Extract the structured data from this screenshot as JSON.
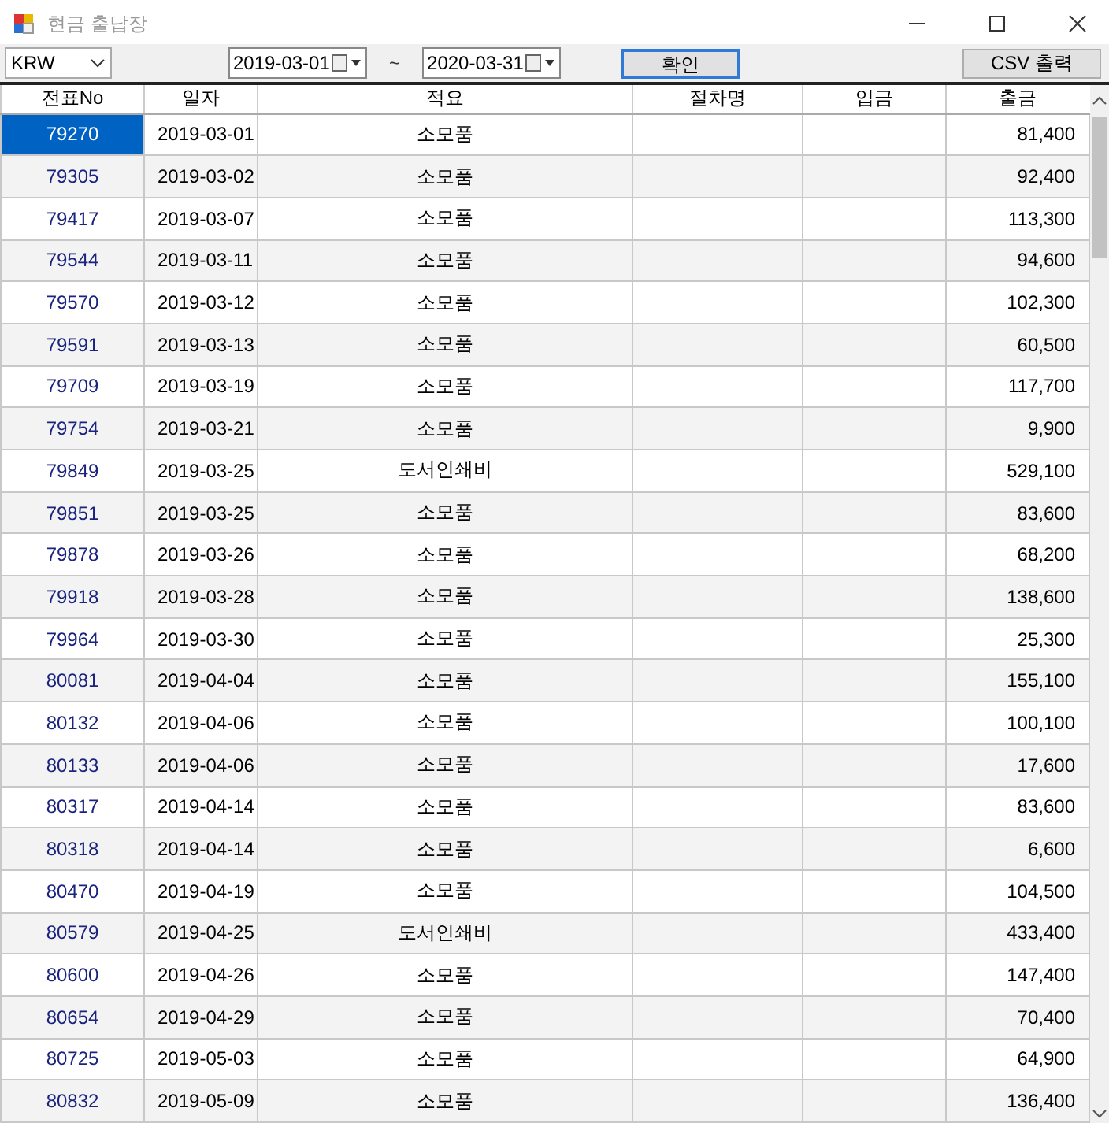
{
  "window": {
    "title": "현금 출납장"
  },
  "toolbar": {
    "currency": "KRW",
    "date_from": "2019-03-01",
    "separator": "~",
    "date_to": "2020-03-31",
    "confirm_button": "확인",
    "export_button": "CSV 출력"
  },
  "table": {
    "columns": [
      "전표No",
      "일자",
      "적요",
      "절차명",
      "입금",
      "출금"
    ],
    "rows": [
      {
        "no": "79270",
        "date": "2019-03-01",
        "memo": "소모품",
        "out": "81,400",
        "selected": true
      },
      {
        "no": "79305",
        "date": "2019-03-02",
        "memo": "소모품",
        "out": "92,400",
        "selected": false
      },
      {
        "no": "79417",
        "date": "2019-03-07",
        "memo": "소모품",
        "out": "113,300",
        "selected": false
      },
      {
        "no": "79544",
        "date": "2019-03-11",
        "memo": "소모품",
        "out": "94,600",
        "selected": false
      },
      {
        "no": "79570",
        "date": "2019-03-12",
        "memo": "소모품",
        "out": "102,300",
        "selected": false
      },
      {
        "no": "79591",
        "date": "2019-03-13",
        "memo": "소모품",
        "out": "60,500",
        "selected": false
      },
      {
        "no": "79709",
        "date": "2019-03-19",
        "memo": "소모품",
        "out": "117,700",
        "selected": false
      },
      {
        "no": "79754",
        "date": "2019-03-21",
        "memo": "소모품",
        "out": "9,900",
        "selected": false
      },
      {
        "no": "79849",
        "date": "2019-03-25",
        "memo": "도서인쇄비",
        "out": "529,100",
        "selected": false
      },
      {
        "no": "79851",
        "date": "2019-03-25",
        "memo": "소모품",
        "out": "83,600",
        "selected": false
      },
      {
        "no": "79878",
        "date": "2019-03-26",
        "memo": "소모품",
        "out": "68,200",
        "selected": false
      },
      {
        "no": "79918",
        "date": "2019-03-28",
        "memo": "소모품",
        "out": "138,600",
        "selected": false
      },
      {
        "no": "79964",
        "date": "2019-03-30",
        "memo": "소모품",
        "out": "25,300",
        "selected": false
      },
      {
        "no": "80081",
        "date": "2019-04-04",
        "memo": "소모품",
        "out": "155,100",
        "selected": false
      },
      {
        "no": "80132",
        "date": "2019-04-06",
        "memo": "소모품",
        "out": "100,100",
        "selected": false
      },
      {
        "no": "80133",
        "date": "2019-04-06",
        "memo": "소모품",
        "out": "17,600",
        "selected": false
      },
      {
        "no": "80317",
        "date": "2019-04-14",
        "memo": "소모품",
        "out": "83,600",
        "selected": false
      },
      {
        "no": "80318",
        "date": "2019-04-14",
        "memo": "소모품",
        "out": "6,600",
        "selected": false
      },
      {
        "no": "80470",
        "date": "2019-04-19",
        "memo": "소모품",
        "out": "104,500",
        "selected": false
      },
      {
        "no": "80579",
        "date": "2019-04-25",
        "memo": "도서인쇄비",
        "out": "433,400",
        "selected": false
      },
      {
        "no": "80600",
        "date": "2019-04-26",
        "memo": "소모품",
        "out": "147,400",
        "selected": false
      },
      {
        "no": "80654",
        "date": "2019-04-29",
        "memo": "소모품",
        "out": "70,400",
        "selected": false
      },
      {
        "no": "80725",
        "date": "2019-05-03",
        "memo": "소모품",
        "out": "64,900",
        "selected": false
      },
      {
        "no": "80832",
        "date": "2019-05-09",
        "memo": "소모품",
        "out": "136,400",
        "selected": false
      }
    ]
  }
}
